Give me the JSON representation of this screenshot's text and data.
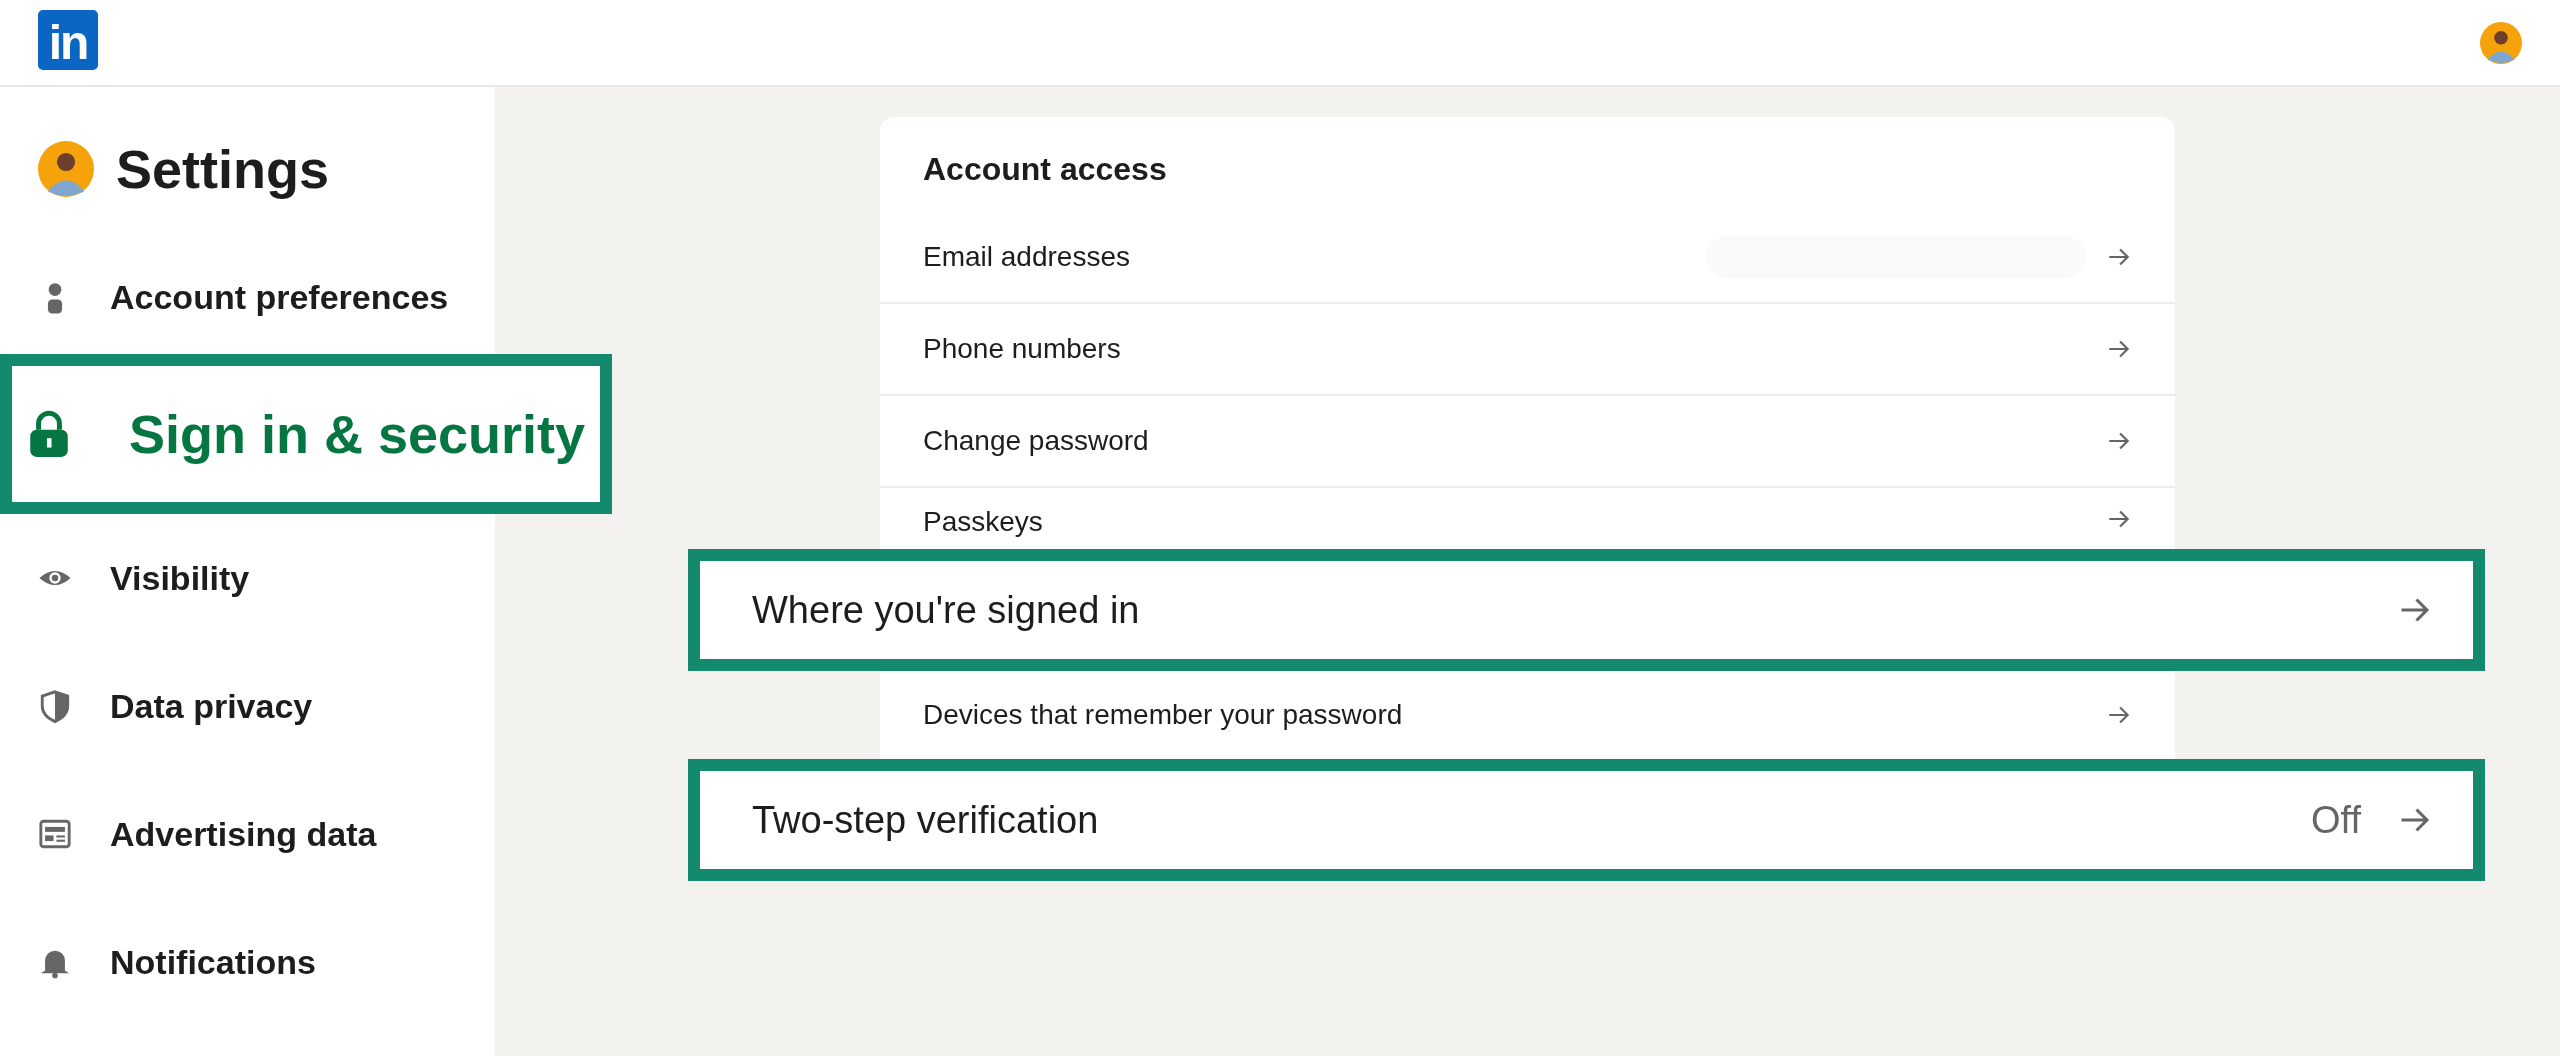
{
  "header": {
    "logo": "in"
  },
  "sidebar": {
    "title": "Settings",
    "items": [
      {
        "label": "Account preferences",
        "selected": false,
        "highlighted": false
      },
      {
        "label": "Sign in & security",
        "selected": true,
        "highlighted": true
      },
      {
        "label": "Visibility",
        "selected": false,
        "highlighted": false
      },
      {
        "label": "Data privacy",
        "selected": false,
        "highlighted": false
      },
      {
        "label": "Advertising data",
        "selected": false,
        "highlighted": false
      },
      {
        "label": "Notifications",
        "selected": false,
        "highlighted": false
      }
    ]
  },
  "card": {
    "title": "Account access",
    "rows": [
      {
        "label": "Email addresses",
        "highlighted": false,
        "redacted": true
      },
      {
        "label": "Phone numbers",
        "highlighted": false
      },
      {
        "label": "Change password",
        "highlighted": false
      },
      {
        "label": "Passkeys",
        "highlighted": false
      },
      {
        "label": "Where you're signed in",
        "highlighted": true
      },
      {
        "label": "Devices that remember your password",
        "highlighted": false
      },
      {
        "label": "Two-step verification",
        "highlighted": true,
        "value": "Off"
      }
    ]
  }
}
